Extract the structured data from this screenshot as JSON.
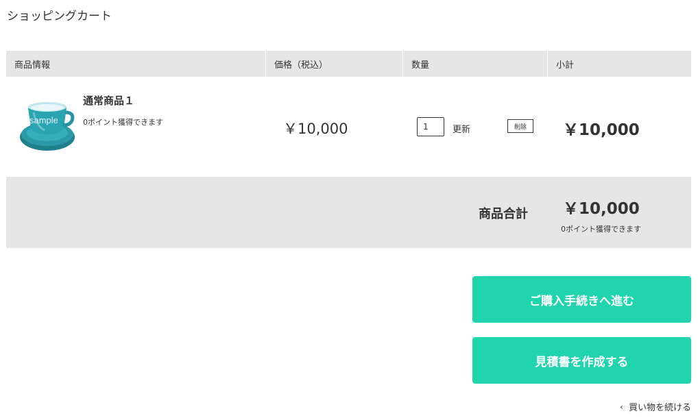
{
  "page": {
    "title": "ショッピングカート"
  },
  "table": {
    "headers": {
      "product": "商品情報",
      "price": "価格（税込）",
      "quantity": "数量",
      "subtotal": "小計"
    }
  },
  "items": [
    {
      "image_label": "sample",
      "name": "通常商品１",
      "points": "0ポイント獲得できます",
      "price": "￥10,000",
      "quantity": "1",
      "update_label": "更新",
      "delete_label": "削除",
      "subtotal": "￥10,000"
    }
  ],
  "summary": {
    "label": "商品合計",
    "total": "￥10,000",
    "points": "0ポイント獲得できます"
  },
  "actions": {
    "checkout_label": "ご購入手続きへ進む",
    "quote_label": "見積書を作成する",
    "continue_label": "買い物を続ける"
  },
  "colors": {
    "accent": "#20d5ae",
    "header_bg": "#e6e6e6",
    "text": "#333333"
  }
}
